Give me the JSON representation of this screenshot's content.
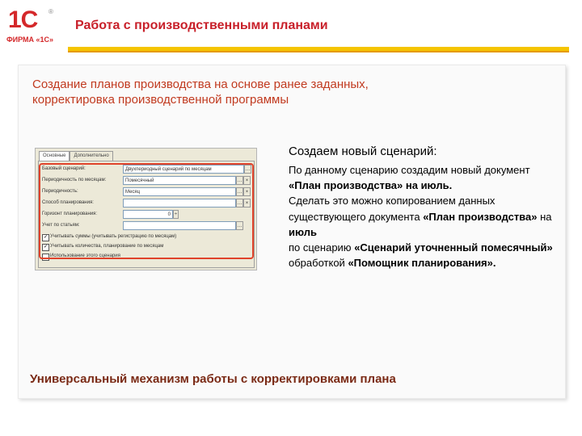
{
  "header": {
    "logo_text": "1С",
    "logo_firm": "ФИРМА «1С»",
    "title": "Работа с производственными планами"
  },
  "subtitle": "Создание планов производства на основе ранее заданных, корректировка производственной программы",
  "scenario": {
    "heading": "Создаем новый сценарий:",
    "p1": "По данному сценарию создадим новый документ",
    "p2_bold": "«План производства» на июль.",
    "p3": "Сделать это можно копированием данных существующего документа",
    "p4_bold": "«План производства»",
    "p4_rest": "на",
    "p5_bold": "июль",
    "p6": "по сценарию",
    "p6_bold": "«Сценарий уточненный помесячный»",
    "p7": "обработкой",
    "p7_bold": "«Помощник планирования»."
  },
  "footer": "Универсальный механизм работы с корректировками плана",
  "form": {
    "tabs": [
      "Основные",
      "Дополнительно"
    ],
    "fields": [
      {
        "label": "Базовый сценарий:",
        "value": "Двухпериодный сценарий по месяцам"
      },
      {
        "label": "Периодичность по месяцам:",
        "value": "Помесячный"
      },
      {
        "label": "Периодичность:",
        "value": "Месяц"
      },
      {
        "label": "Способ планирования:",
        "value": ""
      },
      {
        "label": "Горизонт планирования:",
        "value": "0"
      },
      {
        "label": "Учет по статьям:",
        "value": ""
      }
    ],
    "checks": [
      {
        "label": "Учитывать суммы (учитывать регистрацию по месяцам)",
        "checked": true
      },
      {
        "label": "Учитывать количества, планирование по месяцам",
        "checked": true
      },
      {
        "label": "Использование этого сценария",
        "checked": false
      }
    ]
  },
  "colors": {
    "accent": "#c8202a",
    "yellow": "#f5c400",
    "frame": "#e0432b"
  }
}
